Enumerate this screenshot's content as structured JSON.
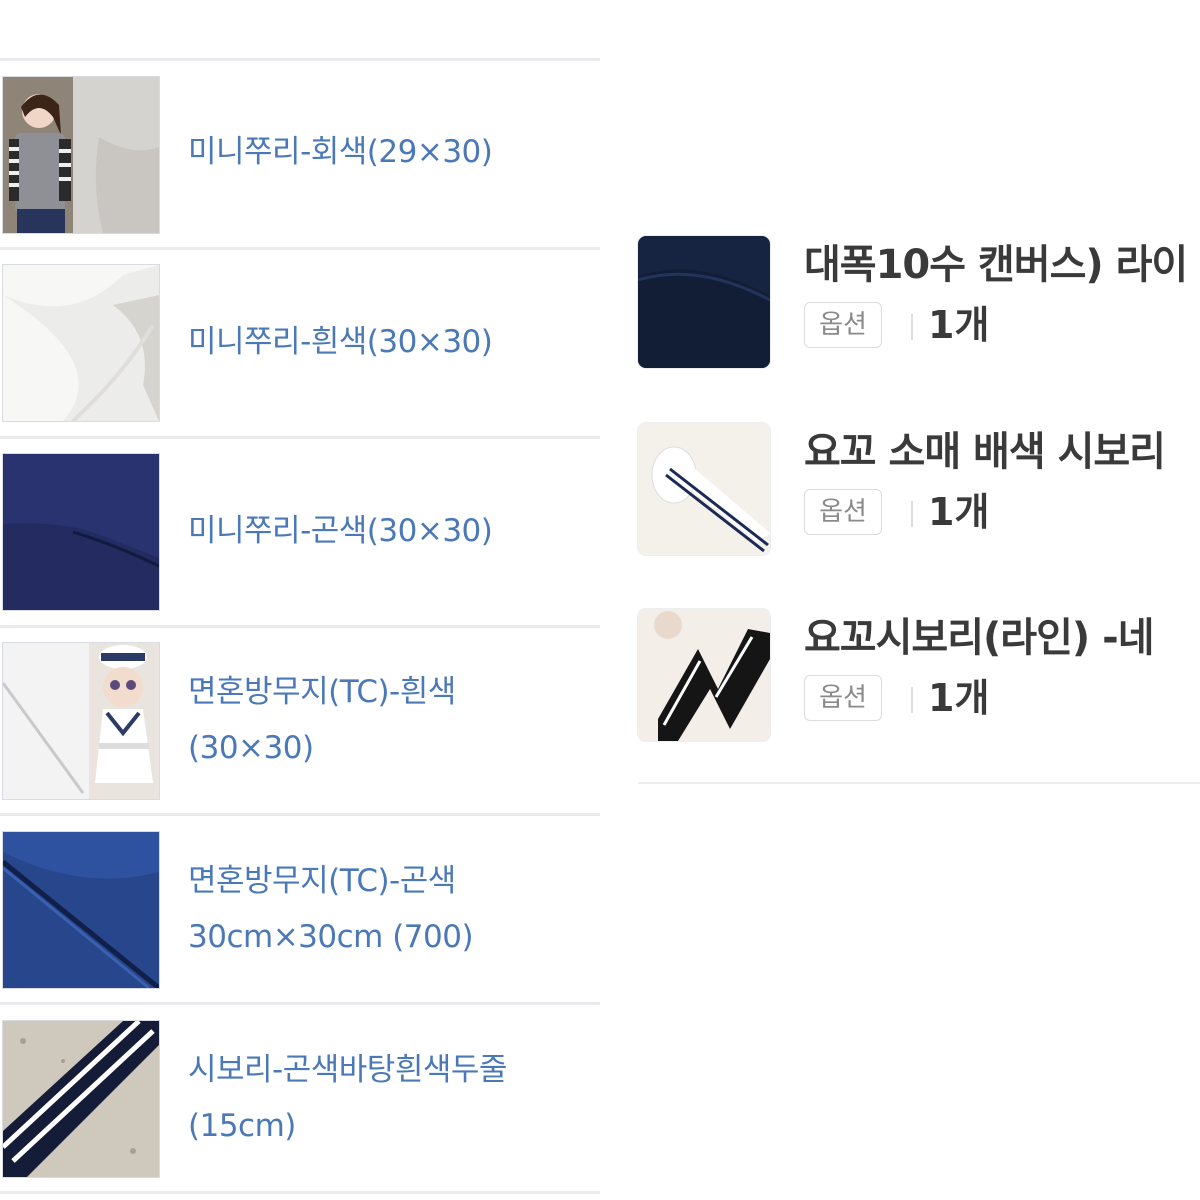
{
  "left_list": {
    "items": [
      {
        "name": "미니쭈리-회색(29×30)"
      },
      {
        "name": "미니쭈리-흰색(30×30)"
      },
      {
        "name": "미니쭈리-곤색(30×30)"
      },
      {
        "name": "면혼방무지(TC)-흰색",
        "name_line2": "(30×30)"
      },
      {
        "name": "면혼방무지(TC)-곤색",
        "name_line2": "30cm×30cm (700)"
      },
      {
        "name": "시보리-곤색바탕흰색두줄",
        "name_line2": "(15cm)"
      }
    ]
  },
  "right_list": {
    "option_label": "옵션",
    "items": [
      {
        "title": "대폭10수 캔버스) 라이",
        "quantity": "1개"
      },
      {
        "title": "요꼬 소매 배색 시보리",
        "quantity": "1개"
      },
      {
        "title": "요꼬시보리(라인) -네",
        "quantity": "1개"
      }
    ]
  },
  "colors": {
    "link_blue": "#4b79b8",
    "divider": "#e9ebee",
    "title_text": "#3a3a3a"
  }
}
